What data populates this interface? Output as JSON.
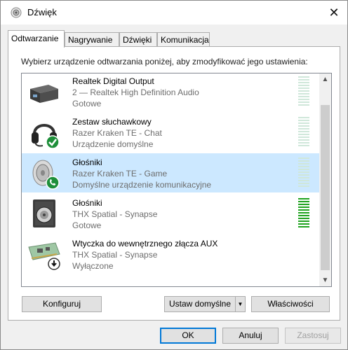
{
  "window": {
    "title": "Dźwięk",
    "close_glyph": "✕"
  },
  "tabs": [
    {
      "label": "Odtwarzanie",
      "active": true
    },
    {
      "label": "Nagrywanie",
      "active": false
    },
    {
      "label": "Dźwięki",
      "active": false
    },
    {
      "label": "Komunikacja",
      "active": false
    }
  ],
  "instruction": "Wybierz urządzenie odtwarzania poniżej, aby zmodyfikować jego ustawienia:",
  "devices": [
    {
      "name": "Realtek Digital Output",
      "subtitle": "2 — Realtek High Definition Audio",
      "status": "Gotowe",
      "icon": "spdif-box-icon",
      "selected": false,
      "level": 0
    },
    {
      "name": "Zestaw słuchawkowy",
      "subtitle": "Razer Kraken TE - Chat",
      "status": "Urządzenie domyślne",
      "icon": "headset-icon",
      "badge": "green-check",
      "selected": false,
      "level": 0
    },
    {
      "name": "Głośniki",
      "subtitle": "Razer Kraken TE - Game",
      "status": "Domyślne urządzenie komunikacyjne",
      "icon": "speaker-icon",
      "badge": "green-phone",
      "selected": true,
      "level": 0
    },
    {
      "name": "Głośniki",
      "subtitle": "THX Spatial - Synapse",
      "status": "Gotowe",
      "icon": "speaker-box-icon",
      "selected": false,
      "level": 1
    },
    {
      "name": "Wtyczka do wewnętrznego złącza AUX",
      "subtitle": "THX Spatial - Synapse",
      "status": "Wyłączone",
      "icon": "circuit-board-icon",
      "badge": "down-arrow",
      "selected": false,
      "level": 0
    }
  ],
  "buttons": {
    "configure": "Konfiguruj",
    "set_default": "Ustaw domyślne",
    "set_default_arrow": "▼",
    "properties": "Właściwości",
    "ok": "OK",
    "cancel": "Anuluj",
    "apply": "Zastosuj"
  },
  "colors": {
    "selection": "#cce8ff",
    "meter_active": "#1fa31f",
    "meter_idle": "#cfe7da",
    "primary_border": "#0078d7"
  }
}
